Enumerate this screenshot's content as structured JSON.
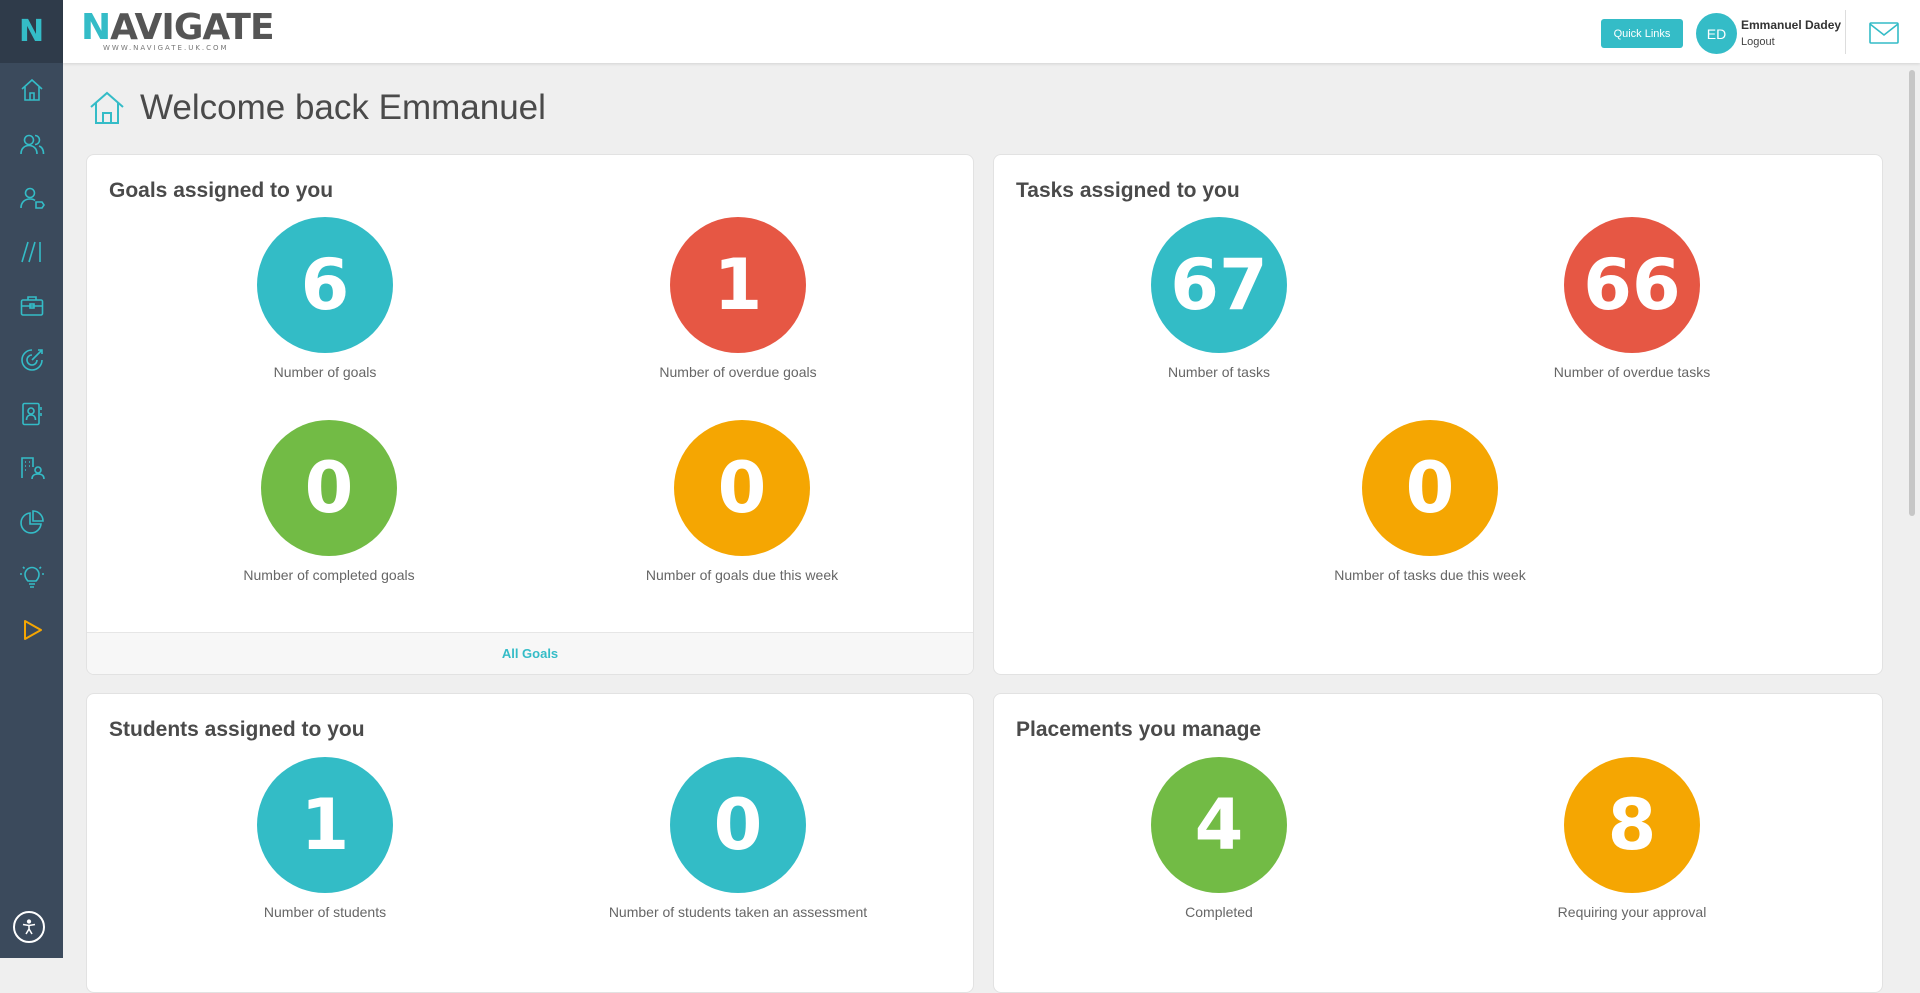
{
  "sidebar": {
    "logo_letter": "N",
    "items": [
      {
        "icon": "home-icon"
      },
      {
        "icon": "users-icon"
      },
      {
        "icon": "user-tag-icon"
      },
      {
        "icon": "slashes-icon"
      },
      {
        "icon": "briefcase-icon"
      },
      {
        "icon": "target-icon"
      },
      {
        "icon": "contact-book-icon"
      },
      {
        "icon": "building-user-icon"
      },
      {
        "icon": "pie-chart-icon"
      },
      {
        "icon": "lightbulb-icon"
      },
      {
        "icon": "play-icon"
      }
    ],
    "accessibility_icon": "accessibility-icon"
  },
  "header": {
    "brand_first_letter": "N",
    "brand_rest": "AVIGATE",
    "brand_url": "WWW.NAVIGATE.UK.COM",
    "quick_links_label": "Quick Links",
    "avatar_initials": "ED",
    "user_name": "Emmanuel Dadey",
    "logout_label": "Logout",
    "mail_icon": "mail-icon"
  },
  "page": {
    "title": "Welcome back Emmanuel"
  },
  "goals": {
    "title": "Goals assigned to you",
    "stats": [
      {
        "value": "6",
        "label": "Number of goals",
        "color": "#33bcc6"
      },
      {
        "value": "1",
        "label": "Number of overdue goals",
        "color": "#e65744"
      },
      {
        "value": "0",
        "label": "Number of completed goals",
        "color": "#72bb45"
      },
      {
        "value": "0",
        "label": "Number of goals due this week",
        "color": "#f5a602"
      }
    ],
    "footer_link": "All Goals"
  },
  "tasks": {
    "title": "Tasks assigned to you",
    "stats": [
      {
        "value": "67",
        "label": "Number of tasks",
        "color": "#33bcc6"
      },
      {
        "value": "66",
        "label": "Number of overdue tasks",
        "color": "#e65744"
      },
      {
        "value": "0",
        "label": "Number of tasks due this week",
        "color": "#f5a602"
      }
    ]
  },
  "students": {
    "title": "Students assigned to you",
    "stats": [
      {
        "value": "1",
        "label": "Number of students",
        "color": "#33bcc6"
      },
      {
        "value": "0",
        "label": "Number of students taken an assessment",
        "color": "#33bcc6"
      }
    ]
  },
  "placements": {
    "title": "Placements you manage",
    "stats": [
      {
        "value": "4",
        "label": "Completed",
        "color": "#72bb45"
      },
      {
        "value": "8",
        "label": "Requiring your approval",
        "color": "#f5a602"
      }
    ]
  }
}
